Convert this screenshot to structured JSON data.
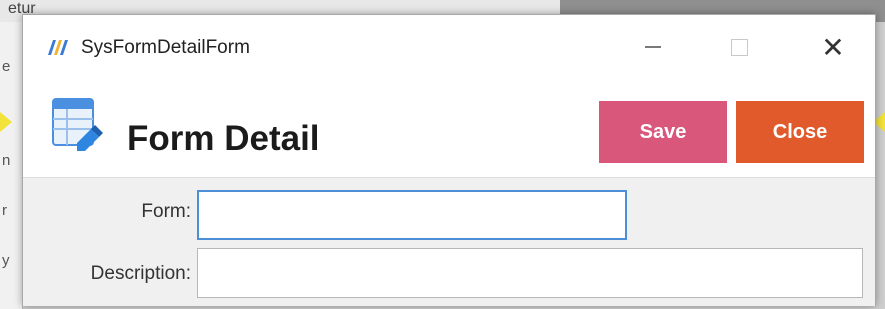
{
  "background": {
    "top_left_text": "etur",
    "edge_letters": [
      "e",
      "n",
      "r",
      "y"
    ]
  },
  "window": {
    "title": "SysFormDetailForm",
    "controls": {
      "minimize": "minimize",
      "maximize": "maximize",
      "close_glyph": "✕"
    }
  },
  "header": {
    "title": "Form Detail",
    "icon": "form-table-icon"
  },
  "toolbar": {
    "save_label": "Save",
    "close_label": "Close"
  },
  "fields": {
    "form": {
      "label": "Form:",
      "value": ""
    },
    "description": {
      "label": "Description:",
      "value": ""
    }
  },
  "colors": {
    "save_button": "#d9577a",
    "close_button": "#e05a2b",
    "focus_border": "#4d8fd6"
  }
}
